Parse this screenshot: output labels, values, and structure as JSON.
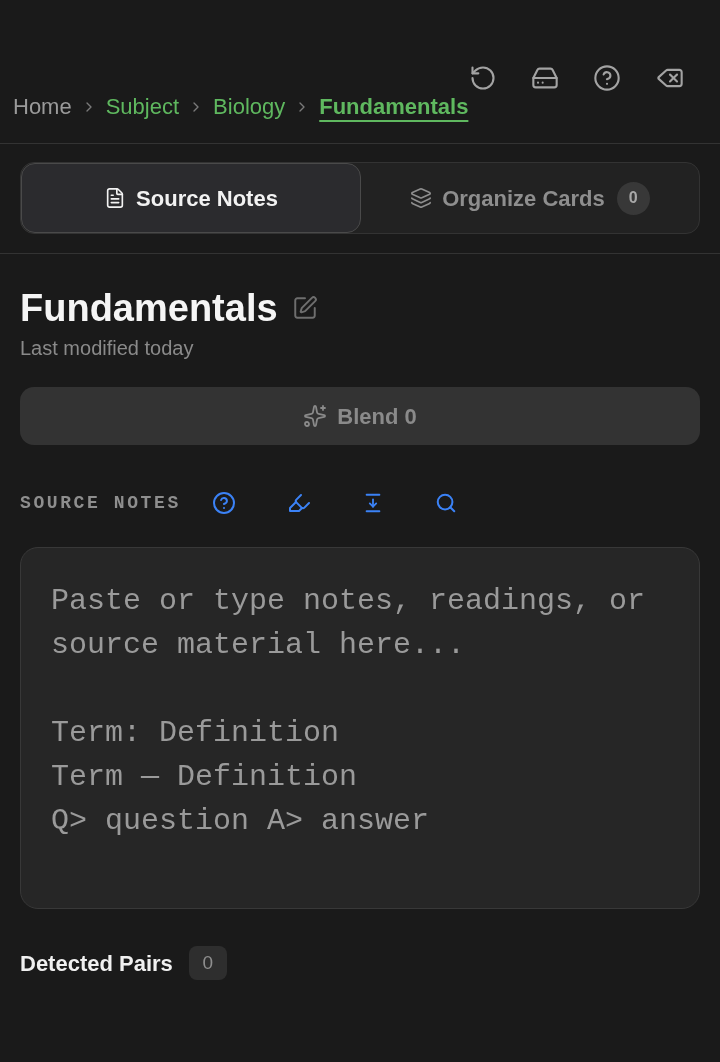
{
  "breadcrumb": [
    {
      "label": "Home",
      "kind": "home",
      "selected": false
    },
    {
      "label": "Subject",
      "kind": "link",
      "selected": false
    },
    {
      "label": "Biology",
      "kind": "link",
      "selected": false
    },
    {
      "label": "Fundamentals",
      "kind": "link",
      "selected": true
    }
  ],
  "tabs": [
    {
      "label": "Source Notes",
      "kind": "notes",
      "selected": true
    },
    {
      "label": "Organize Cards",
      "kind": "cards",
      "selected": false,
      "badge": "0"
    }
  ],
  "note": {
    "title": "Fundamentals",
    "modified": "Last modified today"
  },
  "blend_button": {
    "label": "Blend 0",
    "disabled": true
  },
  "source_notes": {
    "heading": "SOURCE NOTES",
    "placeholder": "Paste or type notes, readings, or\nsource material here...\n\nTerm: Definition\nTerm — Definition\nQ> question A> answer"
  },
  "detected_pairs": {
    "label": "Detected Pairs",
    "count": "0"
  }
}
